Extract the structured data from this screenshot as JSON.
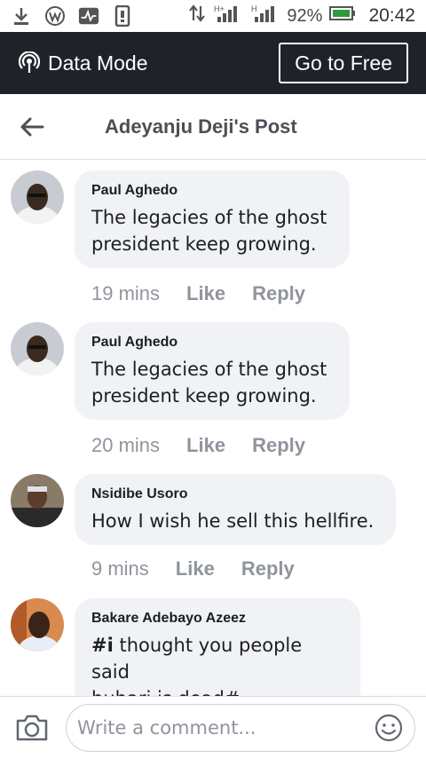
{
  "status_bar": {
    "left_icons": [
      "download-icon",
      "wordpress-icon",
      "activity-icon",
      "sim-icon"
    ],
    "battery_percent": "92%",
    "time": "20:42"
  },
  "data_mode": {
    "label": "Data Mode",
    "go_free_label": "Go to Free"
  },
  "header": {
    "title": "Adeyanju Deji's Post"
  },
  "comments": [
    {
      "author": "Paul Aghedo",
      "text_lines": [
        "The legacies of the ghost",
        "president keep growing."
      ],
      "time": "19 mins",
      "like_label": "Like",
      "reply_label": "Reply"
    },
    {
      "author": "Paul Aghedo",
      "text_lines": [
        "The legacies of the ghost",
        "president keep growing."
      ],
      "time": "20 mins",
      "like_label": "Like",
      "reply_label": "Reply"
    },
    {
      "author": "Nsidibe Usoro",
      "text_lines": [
        "How I wish he sell this hellfire."
      ],
      "time": "9 mins",
      "like_label": "Like",
      "reply_label": "Reply"
    },
    {
      "author": "Bakare Adebayo Azeez",
      "text_prefix_bold": "#i",
      "text_lines": [
        " thought you people said",
        "buhari is dead#"
      ]
    }
  ],
  "composer": {
    "placeholder": "Write a comment..."
  }
}
